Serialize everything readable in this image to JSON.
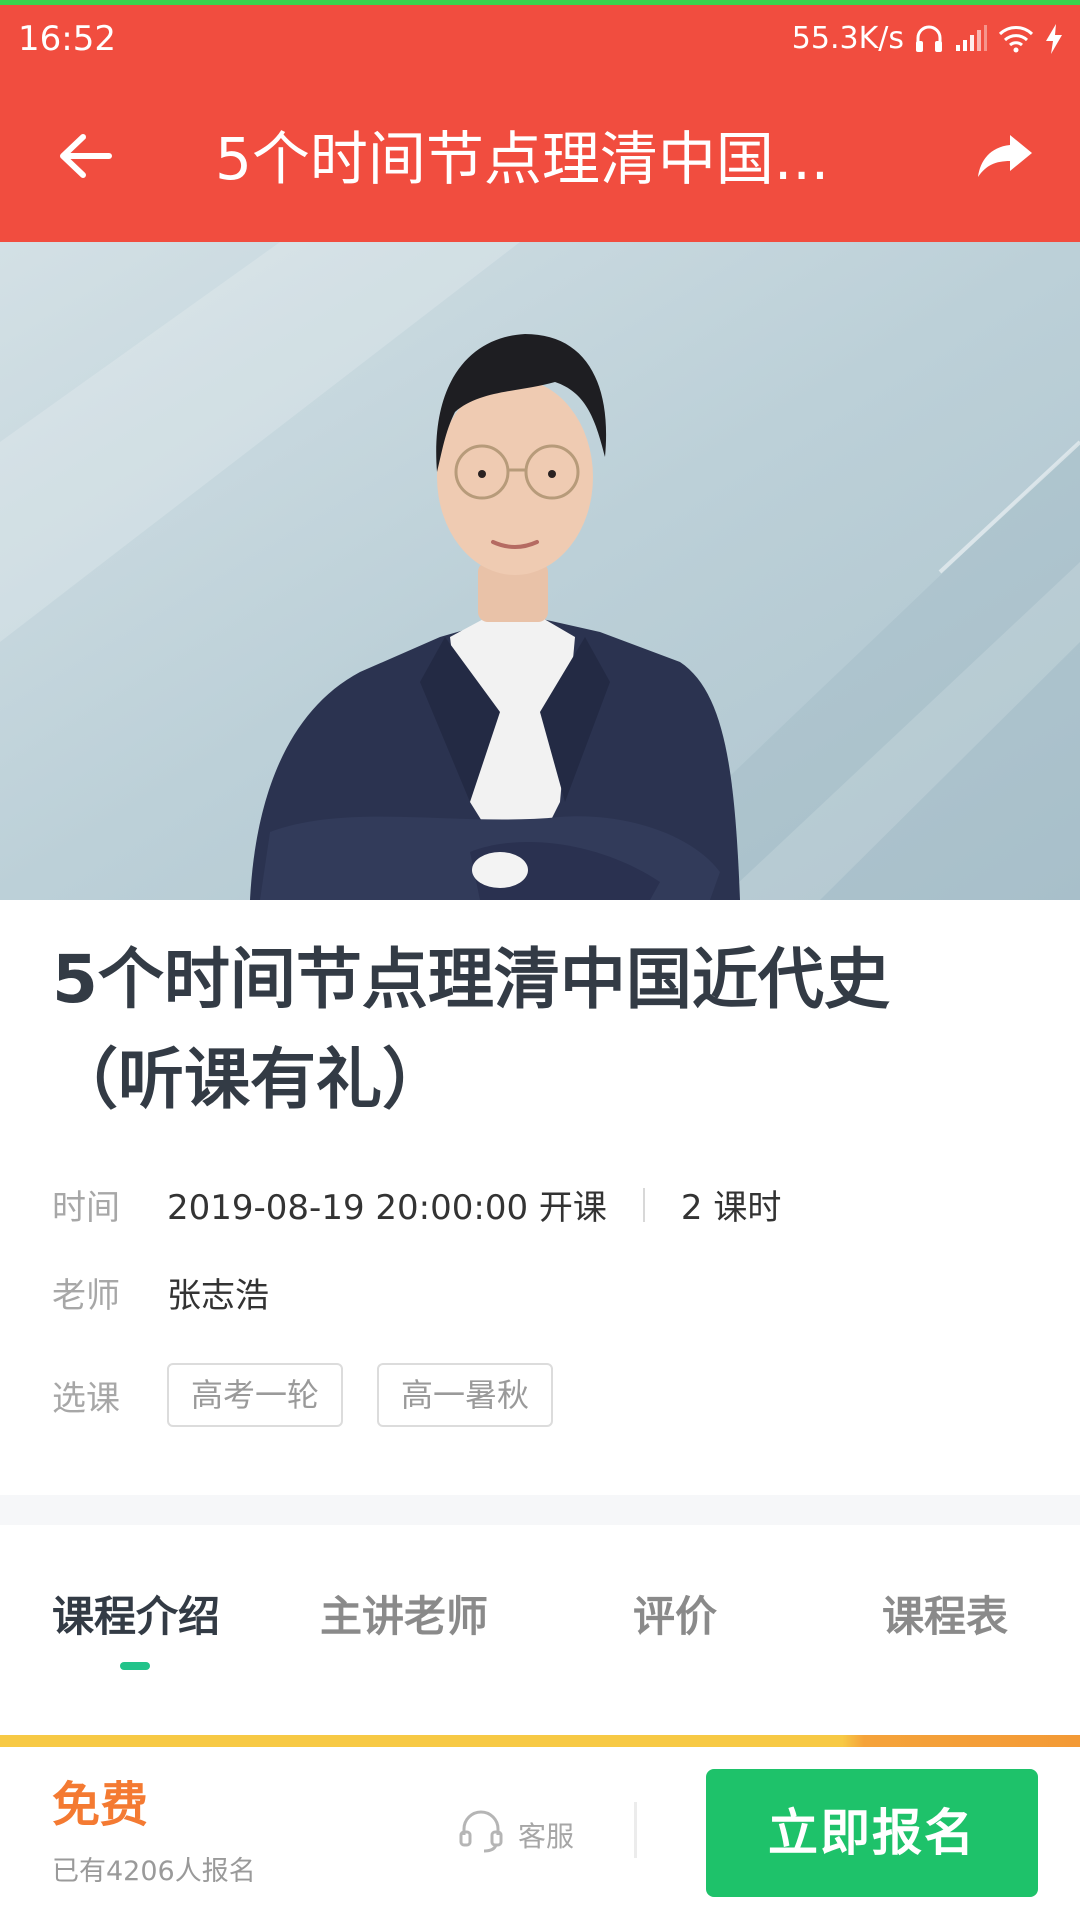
{
  "status_bar": {
    "time": "16:52",
    "net_speed": "55.3K/s"
  },
  "header": {
    "title": "5个时间节点理清中国...",
    "back_icon": "arrow-left-icon",
    "share_icon": "share-arrow-icon"
  },
  "course": {
    "title_line1": "5个时间节点理清中国近代史",
    "title_line2": "（听课有礼）",
    "time_label": "时间",
    "time_value": "2019-08-19 20:00:00 开课",
    "lessons": "2 课时",
    "teacher_label": "老师",
    "teacher_name": "张志浩",
    "select_label": "选课",
    "options": [
      "高考一轮",
      "高一暑秋"
    ]
  },
  "tabs": [
    {
      "label": "课程介绍",
      "active": true
    },
    {
      "label": "主讲老师",
      "active": false
    },
    {
      "label": "评价",
      "active": false
    },
    {
      "label": "课程表",
      "active": false
    }
  ],
  "footer": {
    "price": "免费",
    "enrolled": "已有4206人报名",
    "service_label": "客服",
    "service_icon": "headset-icon",
    "enroll_button": "立即报名"
  },
  "colors": {
    "header_bg": "#f14d3f",
    "accent_green": "#1ec26a",
    "price_orange": "#f47a32",
    "tab_indicator": "#22c38a"
  }
}
